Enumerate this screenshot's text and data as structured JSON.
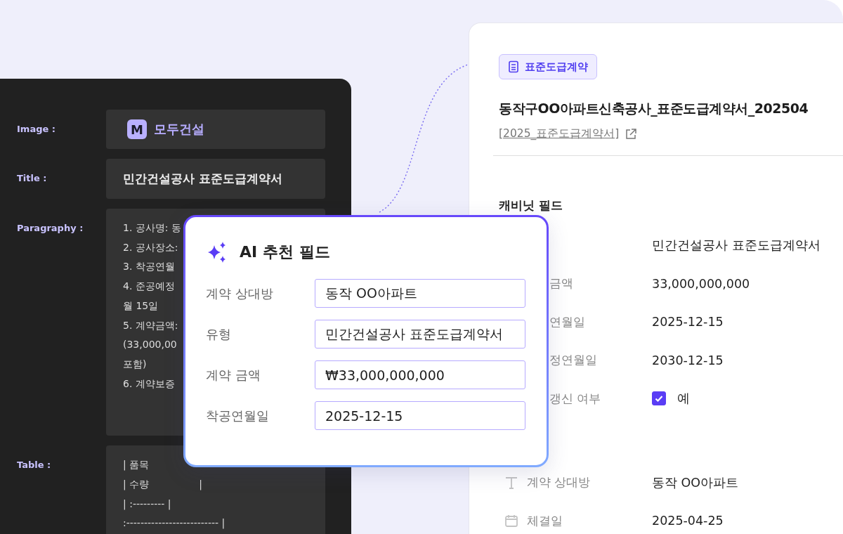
{
  "source_panel": {
    "fields": [
      {
        "label": "Image :",
        "kind": "image",
        "logo_letter": "M",
        "value": "모두건설"
      },
      {
        "label": "Title :",
        "kind": "text",
        "value": "민간건설공사 표준도급계약서"
      },
      {
        "label": "Paragraphy :",
        "kind": "lines",
        "lines": [
          "1. 공사명: 동",
          "2. 공사장소:",
          "3. 착공연월",
          "4. 준공예정",
          "월 15일",
          "5. 계약금액:",
          "(33,000,00",
          "포함)",
          "6. 계약보증"
        ]
      },
      {
        "label": "Table :",
        "kind": "lines",
        "lines": [
          "| 품목",
          "| 수량                |",
          "| :--------- |",
          ":-------------------------- |"
        ]
      }
    ]
  },
  "document_panel": {
    "badge": "표준도급계약",
    "title": "동작구OO아파트신축공사_표준도급계약서_202504",
    "link": "[2025_표준도급계약서]",
    "sections": [
      {
        "title": "캐비닛 필드",
        "rows": [
          {
            "kind": "plain",
            "value": "민간건설공사 표준도급계약서"
          },
          {
            "kind": "plain",
            "label": "금액",
            "value": "33,000,000,000"
          },
          {
            "kind": "plain",
            "label": "연월일",
            "value": "2025-12-15"
          },
          {
            "kind": "plain",
            "label": "정연월일",
            "value": "2030-12-15"
          },
          {
            "kind": "checkbox",
            "label": "갱신 여부",
            "checked": true,
            "value": "예"
          }
        ]
      },
      {
        "rows": [
          {
            "kind": "text",
            "label": "계약 상대방",
            "value": "동작 OO아파트"
          },
          {
            "kind": "date",
            "label": "체결일",
            "value": "2025-04-25"
          }
        ]
      }
    ]
  },
  "ai_popup": {
    "title": "AI 추천 필드",
    "fields": [
      {
        "label": "계약 상대방",
        "value": "동작 OO아파트"
      },
      {
        "label": "유형",
        "value": "민간건설공사 표준도급계약서"
      },
      {
        "label": "계약 금액",
        "value": "₩33,000,000,000"
      },
      {
        "label": "착공연월일",
        "value": "2025-12-15"
      }
    ]
  }
}
